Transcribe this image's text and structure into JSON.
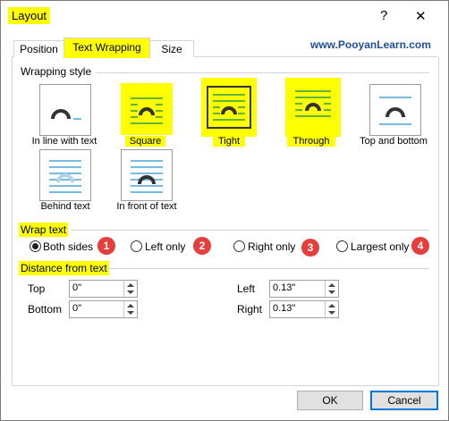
{
  "window": {
    "title": "Layout",
    "help_glyph": "?",
    "close_glyph": "✕"
  },
  "tabs": [
    {
      "label": "Position"
    },
    {
      "label": "Text Wrapping"
    },
    {
      "label": "Size"
    }
  ],
  "watermark": "www.PooyanLearn.com",
  "wrapping_style": {
    "heading": "Wrapping style",
    "options": [
      {
        "label": "In line with text",
        "icon": "inline-wrap-icon"
      },
      {
        "label": "Square",
        "icon": "square-wrap-icon",
        "highlighted": true
      },
      {
        "label": "Tight",
        "icon": "tight-wrap-icon",
        "highlighted": true,
        "selected": true
      },
      {
        "label": "Through",
        "icon": "through-wrap-icon",
        "highlighted": true
      },
      {
        "label": "Top and bottom",
        "icon": "top-bottom-wrap-icon"
      },
      {
        "label": "Behind text",
        "icon": "behind-text-icon"
      },
      {
        "label": "In front of text",
        "icon": "in-front-text-icon"
      }
    ]
  },
  "wrap_text": {
    "heading": "Wrap text",
    "options": [
      {
        "label": "Both sides",
        "checked": true,
        "badge": "1"
      },
      {
        "label": "Left only",
        "checked": false,
        "badge": "2"
      },
      {
        "label": "Right only",
        "checked": false,
        "badge": "3"
      },
      {
        "label": "Largest only",
        "checked": false,
        "badge": "4"
      }
    ]
  },
  "distance": {
    "heading": "Distance from text",
    "top": {
      "label": "Top",
      "value": "0\""
    },
    "bottom": {
      "label": "Bottom",
      "value": "0\""
    },
    "left": {
      "label": "Left",
      "value": "0.13\""
    },
    "right": {
      "label": "Right",
      "value": "0.13\""
    }
  },
  "buttons": {
    "ok": "OK",
    "cancel": "Cancel"
  },
  "colors": {
    "highlight": "#ffff00",
    "badge": "#e63e3a",
    "brand": "#1f4e9c",
    "text_lines": "#4aa3d8"
  }
}
